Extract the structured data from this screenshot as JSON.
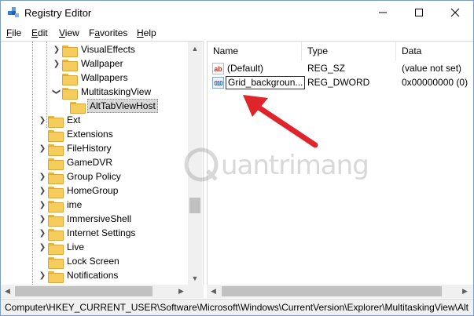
{
  "window": {
    "title": "Registry Editor",
    "controls": {
      "minimize": "minimize-icon",
      "maximize": "maximize-icon",
      "close": "close-icon"
    }
  },
  "menu": {
    "items": [
      {
        "label_ul": "F",
        "label_rest": "ile"
      },
      {
        "label_ul": "E",
        "label_rest": "dit"
      },
      {
        "label_ul": "V",
        "label_rest": "iew"
      },
      {
        "label_pre": "F",
        "label_ul": "a",
        "label_rest": "vorites"
      },
      {
        "label_ul": "H",
        "label_rest": "elp"
      }
    ]
  },
  "tree": {
    "items": [
      {
        "label": "VisualEffects"
      },
      {
        "label": "Wallpaper"
      },
      {
        "label": "Wallpapers"
      },
      {
        "label": "MultitaskingView"
      },
      {
        "label": "AltTabViewHost"
      },
      {
        "label": "Ext"
      },
      {
        "label": "Extensions"
      },
      {
        "label": "FileHistory"
      },
      {
        "label": "GameDVR"
      },
      {
        "label": "Group Policy"
      },
      {
        "label": "HomeGroup"
      },
      {
        "label": "ime"
      },
      {
        "label": "ImmersiveShell"
      },
      {
        "label": "Internet Settings"
      },
      {
        "label": "Live"
      },
      {
        "label": "Lock Screen"
      },
      {
        "label": "Notifications"
      }
    ]
  },
  "list": {
    "columns": [
      "Name",
      "Type",
      "Data"
    ],
    "rows": [
      {
        "icon": "string-value-icon",
        "icon_text": "ab",
        "name": "(Default)",
        "type": "REG_SZ",
        "data": "(value not set)"
      },
      {
        "icon": "binary-value-icon",
        "icon_text": "010",
        "name": "Grid_backgroun...",
        "type": "REG_DWORD",
        "data": "0x00000000 (0)"
      }
    ]
  },
  "status": {
    "path": "Computer\\HKEY_CURRENT_USER\\Software\\Microsoft\\Windows\\CurrentVersion\\Explorer\\MultitaskingView\\Alt"
  },
  "watermark": {
    "text": "uantrimang"
  },
  "colors": {
    "folder": "#f6cd5d",
    "selection": "#d9d9d9",
    "arrow": "#e0242b"
  }
}
